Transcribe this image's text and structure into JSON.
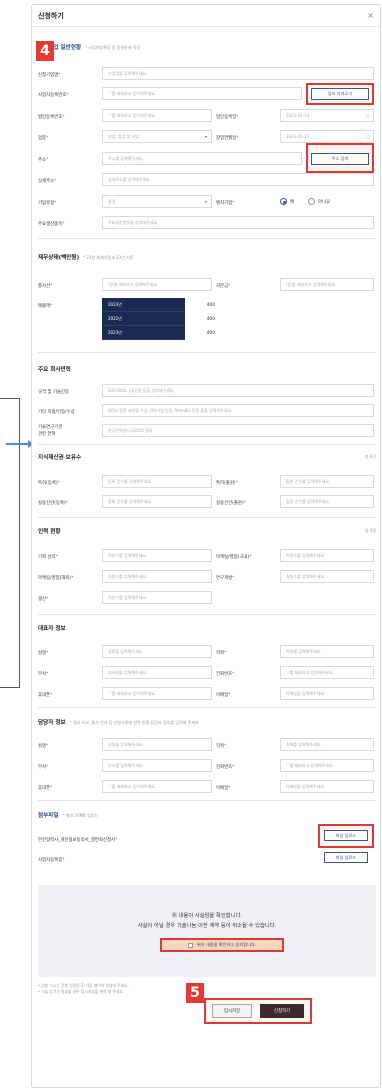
{
  "modal": {
    "title": "신청하기",
    "close": "×"
  },
  "badges": {
    "b4": "4",
    "b5": "5"
  },
  "company": {
    "title": "신청기업 일반현황",
    "subtitle": "* 사업자등록증 등 동일하게 작성",
    "fields": {
      "name_label": "신청기업명",
      "name_ph": "기업명을 입력해주세요.",
      "bizno_label": "사업자등록번호",
      "bizno_ph": "'-'를 제외하고 입력해주세요.",
      "fetch_btn": "정보 가져오기",
      "corpno_label": "법인등록번호",
      "corpno_ph": "'-'를 제외하고 입력해주세요.",
      "corpdate_label": "법인등록일",
      "corpdate_ph": "2023-01-23",
      "industry_label": "업종",
      "industry_ph": "농업, 임업 및 어업",
      "founded_label": "창업연월일",
      "founded_ph": "2023-01-23",
      "address_label": "주소",
      "address_ph": "주소를 검색해주세요.",
      "address_btn": "주소 검색",
      "detail_label": "상세주소",
      "detail_ph": "상세주소를 입력해주세요.",
      "type_label": "기업유형",
      "type_ph": "중견",
      "venture_label": "벤처기업",
      "yes": "예",
      "no": "아니요",
      "product_label": "주요생산품목",
      "product_ph": "주요생산품목을 입력해주세요."
    }
  },
  "finance": {
    "title": "재무상태(백만원)",
    "subtitle": "* 23년 회계기준과 23년 기준",
    "assets_label": "총자산",
    "assets_ph": "'원'을 제외하고 입력해주세요.",
    "capital_label": "자본금",
    "capital_ph": "'원'을 제외하고 입력해주세요.",
    "sales_label": "매출액",
    "rows": [
      {
        "year": "2023년",
        "value": "400"
      },
      {
        "year": "2022년",
        "value": "400"
      },
      {
        "year": "2023년",
        "value": "400"
      }
    ]
  },
  "history": {
    "title": "주요 회사연혁",
    "cert_label": "규격 및 기술인증",
    "cert_ph": "ISO 0000, CE인증 등을 입력해주세요.",
    "other_label": "기타 지정/인증/수상",
    "other_ph": "OO부 장관 표창장 수상, OO기업 인증, MainBiz 인증 등을 입력해주세요.",
    "lab_label1": "기술연구기관",
    "lab_label2": "관련 연혁",
    "lab_ph": "한국전력공사 OOOO 협약"
  },
  "ip": {
    "title": "지식재산권 보유수",
    "right": "총 0건",
    "patent_reg_label": "특허(등록)",
    "patent_reg_ph": "등록 건수를 입력해주세요.",
    "patent_app_label": "특허(출원)",
    "patent_app_ph": "출원 건수를 입력해주세요.",
    "utility_reg_label": "실용신안(등록)",
    "utility_reg_ph": "등록 건수를 입력해주세요.",
    "utility_app_label": "실용신안(출원)",
    "utility_app_ph": "출원 건수를 입력해주세요."
  },
  "staff": {
    "title": "인력 현황",
    "right": "총 0명",
    "plan_label": "기획 관리",
    "ph": "직원수를 입력해주세요.",
    "market_label": "마케팅/영업(국내)",
    "market2_label": "마케팅/영업(해외)",
    "rnd_label": "연구개발",
    "prod_label": "생산"
  },
  "ceo": {
    "title": "대표자 정보",
    "name_label": "성명",
    "name_ph": "성명을 입력해주세요.",
    "pos_label": "직위",
    "pos_ph": "직위를 입력해주세요.",
    "dept_label": "부서",
    "dept_ph": "부서명을 입력해주세요.",
    "tel_label": "전화번호",
    "tel_ph": "'-'를 제외하고 입력해주세요.",
    "mobile_label": "휴대폰",
    "mobile_ph": "'-'를 제외하고 입력해주세요.",
    "email_label": "이메일",
    "email_ph": "이메일을 입력해주세요."
  },
  "manager": {
    "title": "담당자 정보",
    "subtitle": "* 결과 도보, 행사 안내 등 신청사항에 연락 받을 담당자 정보를 입력해 주세요",
    "name_label": "성명",
    "name_ph": "성명을 입력해주세요.",
    "pos_label": "직위",
    "pos_ph": "직위를 입력해주세요.",
    "dept_label": "부서",
    "dept_ph": "부서를 입력해주세요.",
    "tel_label": "전화번호",
    "tel_ph": "'-'를 제외하고 입력해주세요.",
    "mobile_label": "휴대폰",
    "mobile_ph": "'-'를 제외하고 입력해주세요.",
    "email_label": "이메일",
    "email_ph": "이메일을 입력해주세요."
  },
  "files": {
    "title": "첨부파일",
    "subtitle": "* 최대 20MB 업로드",
    "f1_label": "한전협력사_개인정보동의서_결연회신청서",
    "upload1": "파일 업로드",
    "f2_label": "사업자등록증",
    "upload2": "파일 업로드"
  },
  "confirm": {
    "line1": "위 내용이 사실임을 확인합니다.",
    "line2": "사실이 아닐 경우 기술나눔 이전 계약 등이 취소될 수 있습니다.",
    "agree": "위의 내용을 확인하고 동의합니다.",
    "note1": "* 신청 기소는 진행 선정된 후 다음 페이지 안내에 주세요.",
    "note2": "* 기술 추가가 필요할 경우 임시저장을 클릭 해 주세요."
  },
  "actions": {
    "temp_save": "임시저장",
    "apply": "신청하기"
  },
  "colors": {
    "accent": "#3a57a8",
    "highlight": "#d93a3a",
    "dark_navy": "#1a2a52"
  }
}
